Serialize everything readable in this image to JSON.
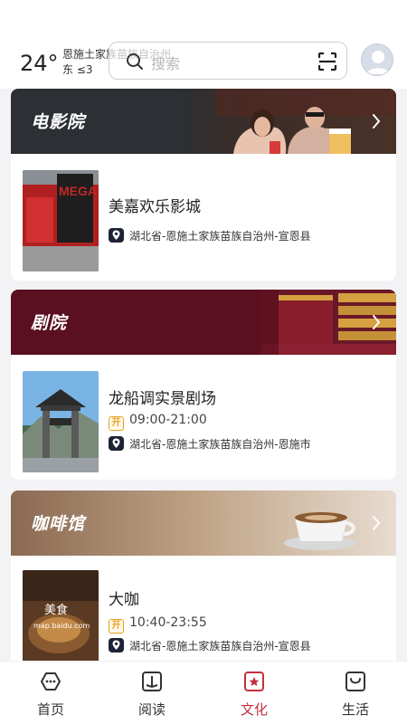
{
  "header": {
    "temperature": "24°",
    "location": "恩施土家族苗族自治州",
    "wind": "东  ≤3",
    "search_placeholder": "搜索"
  },
  "sections": [
    {
      "title": "电影院",
      "venue": {
        "name": "美嘉欢乐影城",
        "address": "湖北省-恩施土家族苗族自治州-宣恩县",
        "thumb_text": "MEGA"
      }
    },
    {
      "title": "剧院",
      "venue": {
        "name": "龙船调实景剧场",
        "hours": "09:00-21:00",
        "address": "湖北省-恩施土家族苗族自治州-恩施市"
      }
    },
    {
      "title": "咖啡馆",
      "venue": {
        "name": "大咖",
        "hours": "10:40-23:55",
        "address": "湖北省-恩施土家族苗族自治州-宣恩县",
        "thumb_text": "美食",
        "thumb_subtext": "map.baidu.com"
      }
    }
  ],
  "open_badge": "开",
  "tabs": [
    {
      "label": "首页",
      "icon": "home-icon"
    },
    {
      "label": "阅读",
      "icon": "book-icon"
    },
    {
      "label": "文化",
      "icon": "star-icon"
    },
    {
      "label": "生活",
      "icon": "bag-icon"
    }
  ],
  "active_tab": "文化",
  "colors": {
    "accent": "#c0303c",
    "cinema_banner": "#2a2d31",
    "theater_banner": "#5a1020",
    "cafe_banner": "#9a7a60"
  }
}
